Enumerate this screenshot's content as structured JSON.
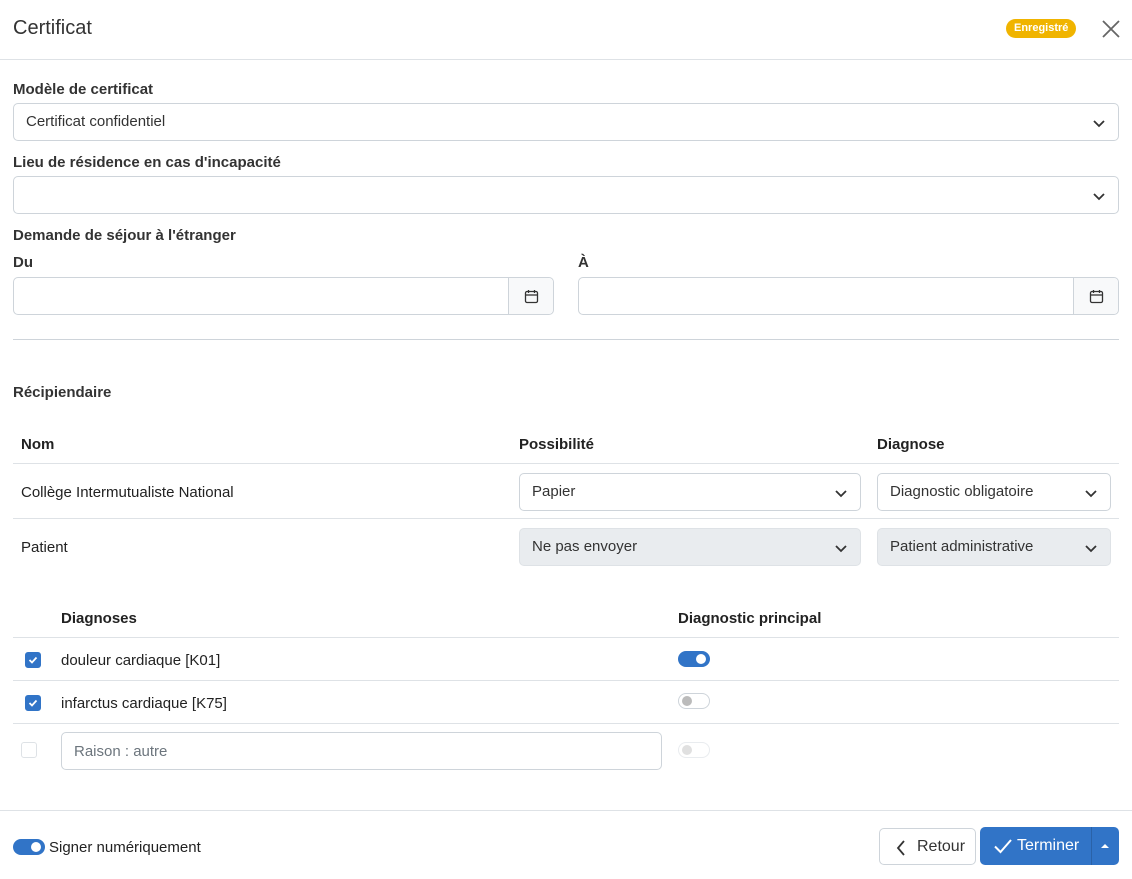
{
  "header": {
    "title": "Certificat",
    "badge": "Enregistré",
    "badge_color": "#f0b400",
    "close_icon": "close-icon"
  },
  "form": {
    "model_label": "Modèle de certificat",
    "model_value": "Certificat confidentiel",
    "residence_label": "Lieu de résidence en cas d'incapacité",
    "residence_value": "",
    "stay_label": "Demande de séjour à l'étranger",
    "from_label": "Du",
    "from_value": "",
    "to_label": "À",
    "to_value": ""
  },
  "recipients": {
    "section_label": "Récipiendaire",
    "columns": [
      "Nom",
      "Possibilité",
      "Diagnose"
    ],
    "rows": [
      {
        "name": "Collège Intermutualiste National",
        "possibility": "Papier",
        "diagnose": "Diagnostic obligatoire",
        "disabled": false
      },
      {
        "name": "Patient",
        "possibility": "Ne pas envoyer",
        "diagnose": "Patient administrative",
        "disabled": true
      }
    ]
  },
  "diagnoses": {
    "columns": [
      "Diagnoses",
      "Diagnostic principal"
    ],
    "rows": [
      {
        "label": "douleur cardiaque [K01]",
        "checked": true,
        "principal": true
      },
      {
        "label": "infarctus cardiaque [K75]",
        "checked": true,
        "principal": false
      }
    ],
    "other_placeholder": "Raison : autre"
  },
  "footer": {
    "sign_label": "Signer numériquement",
    "sign_on": true,
    "back_label": "Retour",
    "finish_label": "Terminer",
    "accent_color": "#3174c7"
  }
}
